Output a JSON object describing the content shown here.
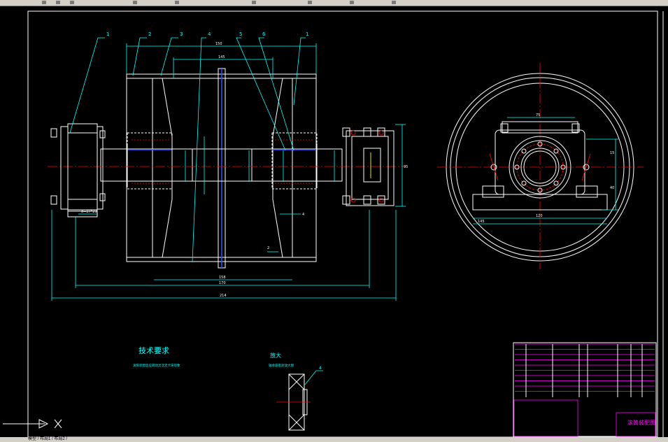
{
  "callouts": [
    "1",
    "2",
    "3",
    "4",
    "5",
    "6",
    "1"
  ],
  "dims": {
    "d145": "145",
    "d150": "150",
    "d158": "158",
    "d170": "170",
    "d214": "214",
    "d75": "75",
    "d120": "120",
    "d95": "95",
    "s4": "4",
    "s2": "2",
    "sigma": "σ=27*23",
    "side75": "75",
    "side15": "15",
    "side40": "40"
  },
  "notes": {
    "tech_title": "技术要求",
    "tech_line": "滚筒装配后应转动灵活无卡滞现象",
    "detail_title": "放大",
    "detail_line": "轴承座密封放大图",
    "detail_callout": "4"
  },
  "title_block": {
    "drawing_name": "滚筒装配图"
  },
  "statusbar": {
    "text": "模型 / 布局1 / 布局2 /"
  },
  "colors": {
    "background": "#000000",
    "outline": "#ffffff",
    "dimension": "#00ffff",
    "table": "#ff00ff",
    "centerline": "#ff0000",
    "shaft_axis": "#3050ff"
  }
}
